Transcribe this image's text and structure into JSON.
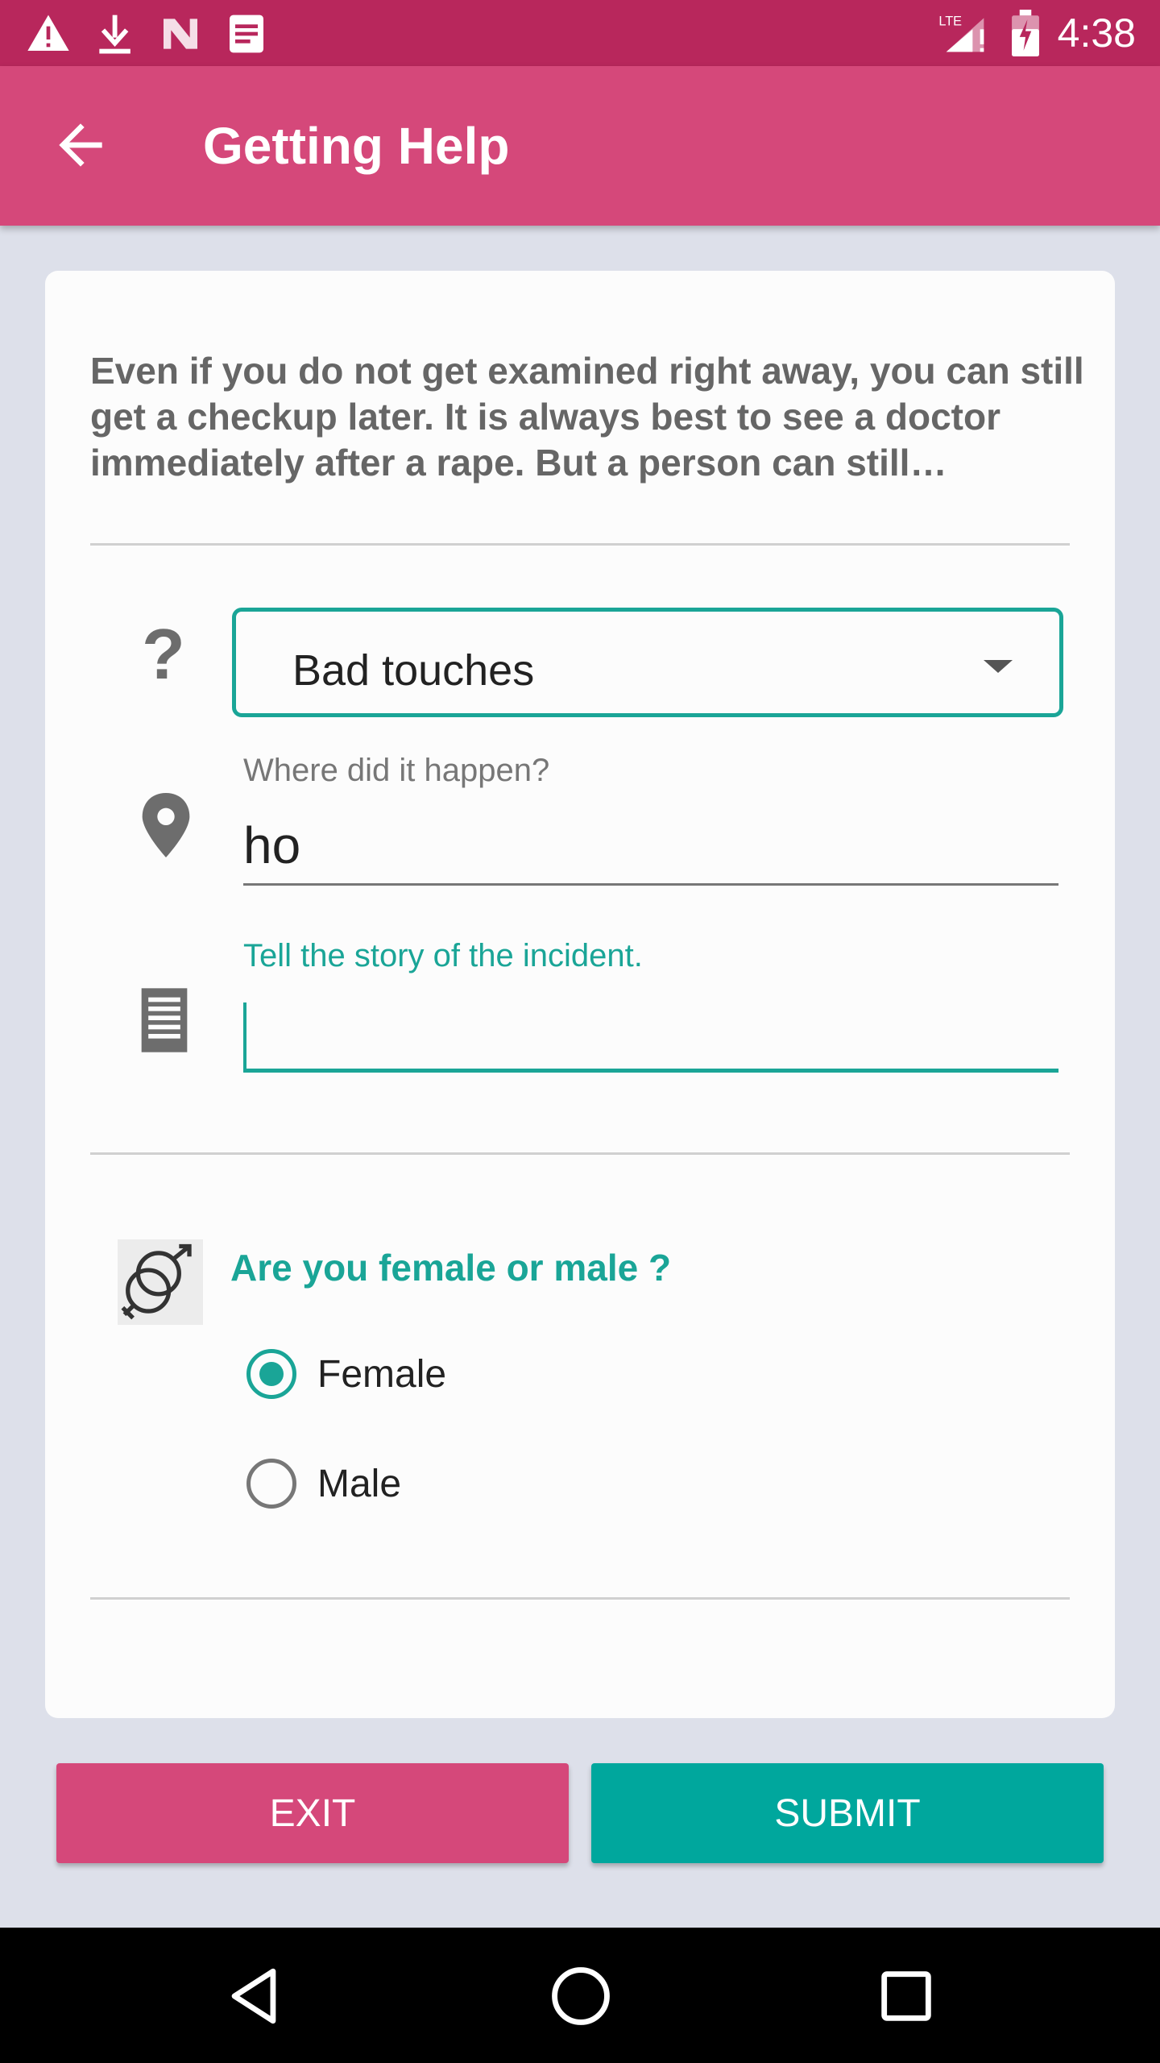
{
  "status_bar": {
    "time": "4:38",
    "network": "LTE",
    "icons": [
      "warning-icon",
      "download-icon",
      "n-app-icon",
      "notes-icon",
      "signal-icon",
      "battery-icon"
    ]
  },
  "app_bar": {
    "title": "Getting Help",
    "back_icon": "arrow-left-icon"
  },
  "card": {
    "description": "Even if you do not get examined right away, you can still get a checkup later. It is always best to see a doctor immediately after a rape. But a person can still…",
    "incident_type": {
      "icon": "question-icon",
      "selected": "Bad touches"
    },
    "location": {
      "label": "Where did it happen?",
      "value": "ho",
      "icon": "location-pin-icon"
    },
    "story": {
      "label": "Tell the story of the incident.",
      "value": "",
      "icon": "document-icon"
    },
    "gender": {
      "question": "Are you female or male ?",
      "icon": "gender-icon",
      "options": [
        {
          "label": "Female",
          "checked": true
        },
        {
          "label": "Male",
          "checked": false
        }
      ]
    }
  },
  "buttons": {
    "exit": "EXIT",
    "submit": "SUBMIT"
  },
  "colors": {
    "status_bar": "#b8275c",
    "app_bar": "#d5487a",
    "accent": "#1aa597",
    "submit": "#00a79d"
  }
}
